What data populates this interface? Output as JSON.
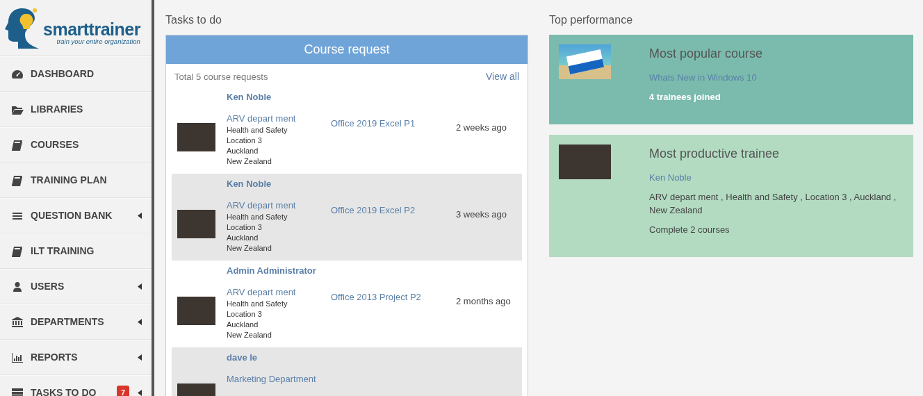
{
  "logo": {
    "name": "smarttrainer",
    "tagline": "train your entire organization"
  },
  "sidebar": {
    "items": [
      {
        "label": "DASHBOARD",
        "has_submenu": false
      },
      {
        "label": "LIBRARIES",
        "has_submenu": false
      },
      {
        "label": "COURSES",
        "has_submenu": false
      },
      {
        "label": "TRAINING PLAN",
        "has_submenu": false
      },
      {
        "label": "QUESTION BANK",
        "has_submenu": true
      },
      {
        "label": "ILT TRAINING",
        "has_submenu": false
      },
      {
        "label": "USERS",
        "has_submenu": true
      },
      {
        "label": "DEPARTMENTS",
        "has_submenu": true
      },
      {
        "label": "REPORTS",
        "has_submenu": true
      },
      {
        "label": "TASKS TO DO",
        "has_submenu": true,
        "badge": "7"
      }
    ]
  },
  "tasks": {
    "heading": "Tasks to do",
    "panel_title": "Course request",
    "summary": "Total 5 course requests",
    "view_all": "View all",
    "requests": [
      {
        "name": "Ken Noble",
        "department": "ARV depart ment",
        "details": [
          "Health and Safety",
          "Location 3",
          "Auckland",
          "New Zealand"
        ],
        "course": "Office 2019 Excel P1",
        "time": "2 weeks ago"
      },
      {
        "name": "Ken Noble",
        "department": "ARV depart ment",
        "details": [
          "Health and Safety",
          "Location 3",
          "Auckland",
          "New Zealand"
        ],
        "course": "Office 2019 Excel P2",
        "time": "3 weeks ago"
      },
      {
        "name": "Admin Administrator",
        "department": "ARV depart ment",
        "details": [
          "Health and Safety",
          "Location 3",
          "Auckland",
          "New Zealand"
        ],
        "course": "Office 2013 Project P2",
        "time": "2 months ago"
      },
      {
        "name": "dave le",
        "department": "Marketing Department"
      }
    ]
  },
  "performance": {
    "heading": "Top performance",
    "cards": [
      {
        "kind": "course",
        "color": "#7bbbad",
        "title": "Most popular course",
        "link": "Whats New in Windows 10",
        "lines": [
          "4 trainees joined"
        ]
      },
      {
        "kind": "trainee",
        "color": "#b2dbc1",
        "title": "Most productive trainee",
        "link": "Ken Noble",
        "lines": [
          "ARV depart ment , Health and Safety , Location 3 , Auckland , New Zealand",
          "Complete 2 courses"
        ]
      }
    ]
  }
}
